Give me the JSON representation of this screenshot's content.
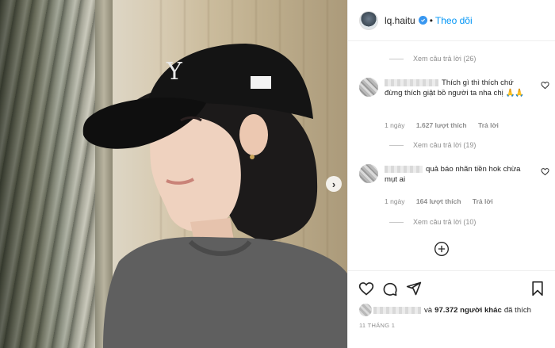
{
  "header": {
    "username": "lq.haitu",
    "separator": "•",
    "follow_label": "Theo dõi"
  },
  "replies": [
    {
      "label": "Xem câu trả lời (26)"
    },
    {
      "label": "Xem câu trả lời (19)"
    },
    {
      "label": "Xem câu trả lời (10)"
    }
  ],
  "comments": [
    {
      "text": "Thích gì thì thích chứ đừng thích giật bồ người ta nha chị 🙏🙏",
      "time": "1 ngày",
      "likes": "1.627 lượt thích",
      "reply_label": "Trả lời"
    },
    {
      "text": "quả báo nhãn tiền hok chừa mụt ai",
      "time": "1 ngày",
      "likes": "164 lượt thích",
      "reply_label": "Trả lời"
    }
  ],
  "likes_line": {
    "connector": "và",
    "count": "97.372 người khác",
    "suffix": "đã thích"
  },
  "date": "11 THÁNG 1",
  "colors": {
    "accent": "#0095f6",
    "verified": "#3897f0",
    "text": "#262626",
    "muted": "#8e8e8e"
  },
  "icons": [
    "verified-badge-icon",
    "heart-icon",
    "comment-icon",
    "share-icon",
    "bookmark-icon",
    "add-comment-icon",
    "chevron-right-icon"
  ]
}
